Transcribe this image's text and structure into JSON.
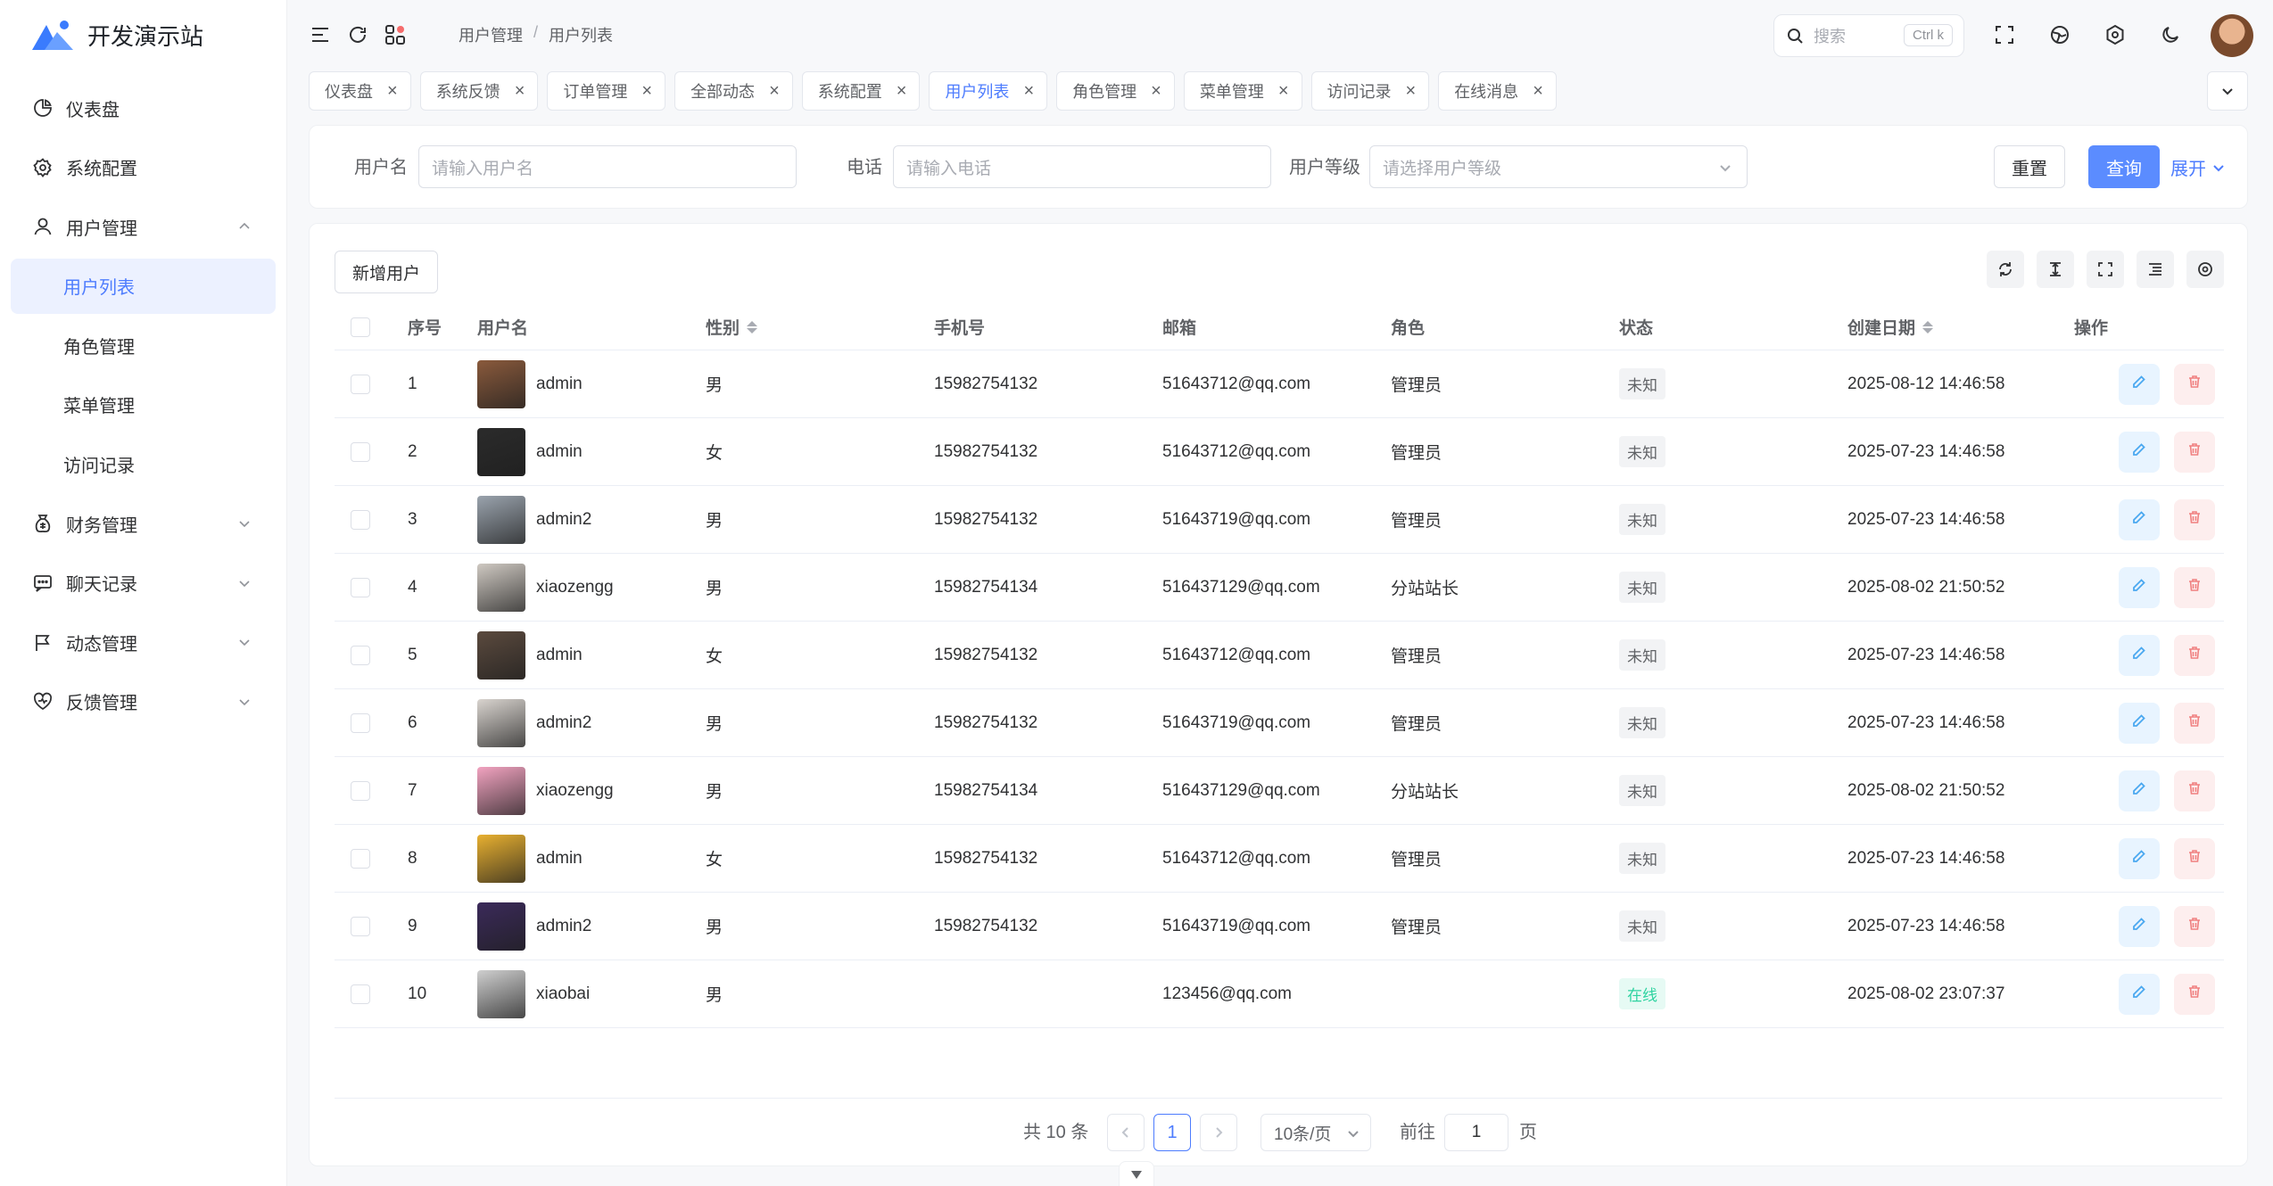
{
  "brand": {
    "name": "开发演示站"
  },
  "sidebar": {
    "items": [
      {
        "label": "仪表盘",
        "icon": "chart-pie-icon",
        "type": "top"
      },
      {
        "label": "系统配置",
        "icon": "gear-icon",
        "type": "top"
      },
      {
        "label": "用户管理",
        "icon": "user-icon",
        "type": "top",
        "expanded": true
      },
      {
        "label": "用户列表",
        "type": "sub",
        "active": true
      },
      {
        "label": "角色管理",
        "type": "sub"
      },
      {
        "label": "菜单管理",
        "type": "sub"
      },
      {
        "label": "访问记录",
        "type": "sub"
      },
      {
        "label": "财务管理",
        "icon": "money-bag-icon",
        "type": "top",
        "expandable": true
      },
      {
        "label": "聊天记录",
        "icon": "chat-icon",
        "type": "top",
        "expandable": true
      },
      {
        "label": "动态管理",
        "icon": "flag-icon",
        "type": "top",
        "expandable": true
      },
      {
        "label": "反馈管理",
        "icon": "heart-icon",
        "type": "top",
        "expandable": true
      }
    ]
  },
  "header": {
    "breadcrumb": [
      "用户管理",
      "用户列表"
    ],
    "search": {
      "placeholder": "搜索",
      "shortcut": "Ctrl k"
    }
  },
  "tabs": [
    {
      "label": "仪表盘",
      "active": false
    },
    {
      "label": "系统反馈",
      "active": false
    },
    {
      "label": "订单管理",
      "active": false
    },
    {
      "label": "全部动态",
      "active": false
    },
    {
      "label": "系统配置",
      "active": false
    },
    {
      "label": "用户列表",
      "active": true
    },
    {
      "label": "角色管理",
      "active": false
    },
    {
      "label": "菜单管理",
      "active": false
    },
    {
      "label": "访问记录",
      "active": false
    },
    {
      "label": "在线消息",
      "active": false
    }
  ],
  "filter": {
    "username_label": "用户名",
    "username_placeholder": "请输入用户名",
    "phone_label": "电话",
    "phone_placeholder": "请输入电话",
    "level_label": "用户等级",
    "level_placeholder": "请选择用户等级",
    "reset": "重置",
    "query": "查询",
    "expand": "展开"
  },
  "table": {
    "add_button": "新增用户",
    "columns": [
      "序号",
      "用户名",
      "性别",
      "手机号",
      "邮箱",
      "角色",
      "状态",
      "创建日期",
      "操作"
    ],
    "rows": [
      {
        "no": "1",
        "name": "admin",
        "gender": "男",
        "phone": "15982754132",
        "email": "51643712@qq.com",
        "role": "管理员",
        "status": "未知",
        "status_type": "unknown",
        "date": "2025-08-12 14:46:58",
        "avatar_color": "#8a5a3c"
      },
      {
        "no": "2",
        "name": "admin",
        "gender": "女",
        "phone": "15982754132",
        "email": "51643712@qq.com",
        "role": "管理员",
        "status": "未知",
        "status_type": "unknown",
        "date": "2025-07-23 14:46:58",
        "avatar_color": "#2b2b2b"
      },
      {
        "no": "3",
        "name": "admin2",
        "gender": "男",
        "phone": "15982754132",
        "email": "51643719@qq.com",
        "role": "管理员",
        "status": "未知",
        "status_type": "unknown",
        "date": "2025-07-23 14:46:58",
        "avatar_color": "#9aa3ad"
      },
      {
        "no": "4",
        "name": "xiaozengg",
        "gender": "男",
        "phone": "15982754134",
        "email": "516437129@qq.com",
        "role": "分站站长",
        "status": "未知",
        "status_type": "unknown",
        "date": "2025-08-02 21:50:52",
        "avatar_color": "#cfc9c2"
      },
      {
        "no": "5",
        "name": "admin",
        "gender": "女",
        "phone": "15982754132",
        "email": "51643712@qq.com",
        "role": "管理员",
        "status": "未知",
        "status_type": "unknown",
        "date": "2025-07-23 14:46:58",
        "avatar_color": "#5b4a3e"
      },
      {
        "no": "6",
        "name": "admin2",
        "gender": "男",
        "phone": "15982754132",
        "email": "51643719@qq.com",
        "role": "管理员",
        "status": "未知",
        "status_type": "unknown",
        "date": "2025-07-23 14:46:58",
        "avatar_color": "#d9d4cf"
      },
      {
        "no": "7",
        "name": "xiaozengg",
        "gender": "男",
        "phone": "15982754134",
        "email": "516437129@qq.com",
        "role": "分站站长",
        "status": "未知",
        "status_type": "unknown",
        "date": "2025-08-02 21:50:52",
        "avatar_color": "#f2a3c0"
      },
      {
        "no": "8",
        "name": "admin",
        "gender": "女",
        "phone": "15982754132",
        "email": "51643712@qq.com",
        "role": "管理员",
        "status": "未知",
        "status_type": "unknown",
        "date": "2025-07-23 14:46:58",
        "avatar_color": "#e8b030"
      },
      {
        "no": "9",
        "name": "admin2",
        "gender": "男",
        "phone": "15982754132",
        "email": "51643719@qq.com",
        "role": "管理员",
        "status": "未知",
        "status_type": "unknown",
        "date": "2025-07-23 14:46:58",
        "avatar_color": "#3b2a5a"
      },
      {
        "no": "10",
        "name": "xiaobai",
        "gender": "男",
        "phone": "",
        "email": "123456@qq.com",
        "role": "",
        "status": "在线",
        "status_type": "online",
        "date": "2025-08-02 23:07:37",
        "avatar_color": "#cfcfcf"
      }
    ]
  },
  "pagination": {
    "total": "共 10 条",
    "current": "1",
    "page_size": "10条/页",
    "goto_label": "前往",
    "goto_value": "1",
    "page_suffix": "页"
  },
  "colors": {
    "primary": "#4d7cfe",
    "online": "#2ed3a0",
    "danger": "#f56c6c"
  }
}
